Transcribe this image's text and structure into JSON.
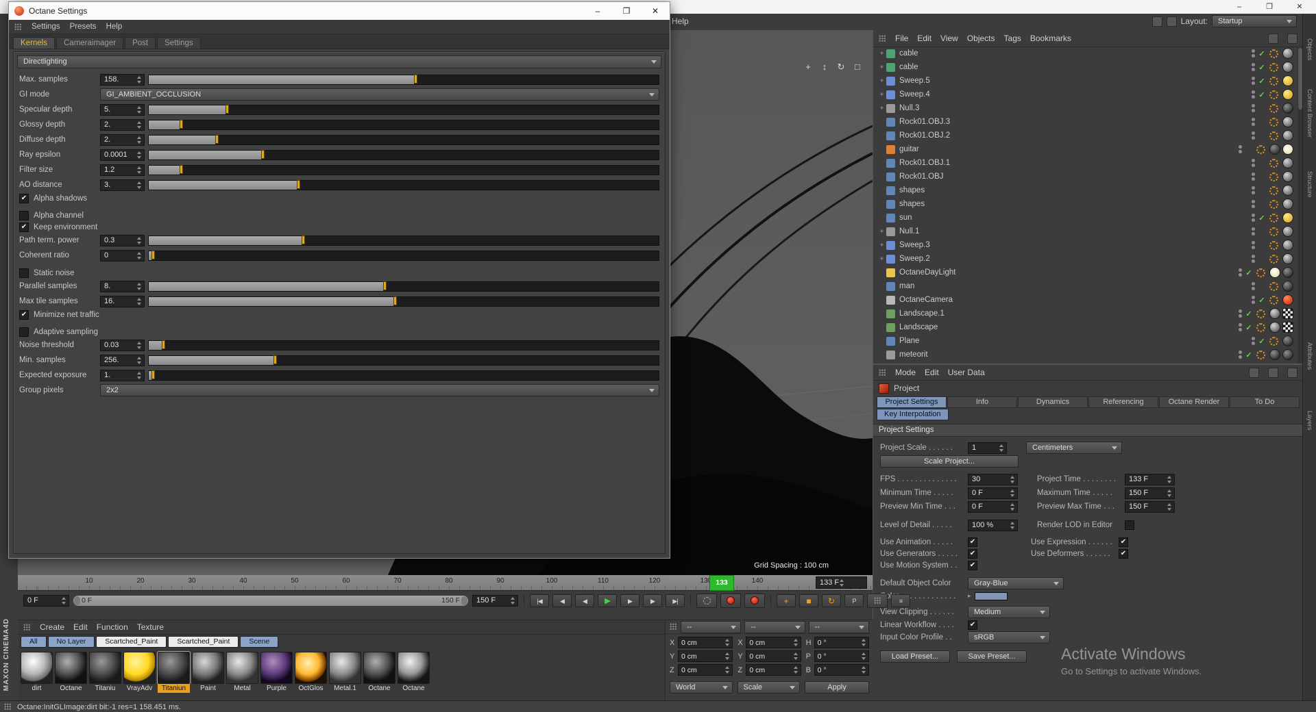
{
  "main": {
    "help": "Help",
    "layout_label": "Layout:",
    "layout_value": "Startup",
    "win_min": "–",
    "win_max": "❐",
    "win_close": "✕",
    "brand": "MAXON CINEMA4D",
    "grid_spacing": "Grid Spacing : 100 cm",
    "watermark1": "Activate Windows",
    "watermark2": "Go to Settings to activate Windows.",
    "status": "Octane:InitGLImage:dirt  bit:-1 res=1  158.451 ms.",
    "nav_icons": [
      "+",
      "↕",
      "↻",
      "□"
    ],
    "side_tabs_top": [
      "Objects",
      "Content Browser",
      "Structure"
    ],
    "side_tabs_bottom": [
      "Attributes",
      "Layers"
    ]
  },
  "dialog": {
    "title": "Octane Settings",
    "menus": [
      "Settings",
      "Presets",
      "Help"
    ],
    "tabs": [
      "Kernels",
      "Cameraimager",
      "Post",
      "Settings"
    ],
    "preset": "Directlighting",
    "rows": [
      {
        "label": "Max. samples",
        "value": "158.",
        "fill": "width:52%"
      },
      {
        "label": "GI mode",
        "value": "GI_AMBIENT_OCCLUSION"
      },
      {
        "label": "Specular depth",
        "value": "5.",
        "fill": "width:15%"
      },
      {
        "label": "Glossy depth",
        "value": "2.",
        "fill": "width:6%"
      },
      {
        "label": "Diffuse depth",
        "value": "2.",
        "fill": "width:13%"
      },
      {
        "label": "Ray epsilon",
        "value": "0.0001",
        "fill": "width:22%"
      },
      {
        "label": "Filter size",
        "value": "1.2",
        "fill": "width:6%"
      },
      {
        "label": "AO distance",
        "value": "3.",
        "fill": "width:29%"
      },
      {
        "label": "Alpha shadows",
        "check": "✔"
      },
      {
        "label": "Alpha channel",
        "check": ""
      },
      {
        "label": "Keep environment",
        "check": "✔"
      },
      {
        "label": "Path term. power",
        "value": "0.3",
        "fill": "width:30%"
      },
      {
        "label": "Coherent ratio",
        "value": "0",
        "fill": "width:0.5%"
      },
      {
        "label": "Static noise",
        "check": ""
      },
      {
        "label": "Parallel samples",
        "value": "8.",
        "fill": "width:46%"
      },
      {
        "label": "Max tile samples",
        "value": "16.",
        "fill": "width:48%"
      },
      {
        "label": "Minimize net traffic",
        "check": "✔"
      },
      {
        "label": "Adaptive sampling",
        "check": ""
      },
      {
        "label": "Noise threshold",
        "value": "0.03",
        "fill": "width:2.5%"
      },
      {
        "label": "Min. samples",
        "value": "256.",
        "fill": "width:24.5%"
      },
      {
        "label": "Expected exposure",
        "value": "1.",
        "fill": "width:0.5%"
      },
      {
        "label": "Group pixels",
        "value": "2x2"
      }
    ]
  },
  "om": {
    "menus": [
      "File",
      "Edit",
      "View",
      "Objects",
      "Tags",
      "Bookmarks"
    ],
    "items": [
      {
        "name": "cable",
        "exp": "+",
        "icon": "background:#4fa372",
        "chk": "✓",
        "t1": "display:inline-block;background:radial-gradient(circle at 35% 30%,#d6d6d6,#404040)"
      },
      {
        "name": "cable",
        "exp": "+",
        "icon": "background:#4fa372",
        "chk": "✓",
        "t1": "display:inline-block;background:radial-gradient(circle at 35% 30%,#d6d6d6,#404040)"
      },
      {
        "name": "Sweep.5",
        "exp": "+",
        "icon": "background:#6e8fd6",
        "chk": "✓",
        "t1": "display:inline-block;background:radial-gradient(circle at 35% 30%,#ffe98a,#cf9d14)"
      },
      {
        "name": "Sweep.4",
        "exp": "+",
        "icon": "background:#6e8fd6",
        "chk": "✓",
        "t1": "display:inline-block;background:radial-gradient(circle at 35% 30%,#ffe98a,#cf9d14)"
      },
      {
        "name": "Null.3",
        "exp": "+",
        "icon": "background:#9a9a9a",
        "t1": "display:inline-block;background:radial-gradient(circle at 35% 30%,#8f8f8f,#101010)"
      },
      {
        "name": "Rock01.OBJ.3",
        "icon": "background:#5f87b7",
        "t1": "display:inline-block;background:radial-gradient(circle at 35% 30%,#d6d6d6,#404040)"
      },
      {
        "name": "Rock01.OBJ.2",
        "icon": "background:#5f87b7",
        "t1": "display:inline-block;background:radial-gradient(circle at 35% 30%,#d6d6d6,#404040)"
      },
      {
        "name": "guitar",
        "icon": "background:#e08030",
        "t1": "display:inline-block;background:radial-gradient(circle at 35% 30%,#8f8f8f,#101010)",
        "t2": "display:inline-block;background:radial-gradient(circle at 45% 40%,#ffffff,#d8d890)"
      },
      {
        "name": "Rock01.OBJ.1",
        "icon": "background:#5f87b7",
        "t1": "display:inline-block;background:radial-gradient(circle at 35% 30%,#d6d6d6,#404040)"
      },
      {
        "name": "Rock01.OBJ",
        "icon": "background:#5f87b7",
        "t1": "display:inline-block;background:radial-gradient(circle at 35% 30%,#d6d6d6,#404040)"
      },
      {
        "name": "shapes",
        "icon": "background:#5f87b7",
        "t1": "display:inline-block;background:radial-gradient(circle at 35% 30%,#d6d6d6,#404040)"
      },
      {
        "name": "shapes",
        "icon": "background:#5f87b7",
        "t1": "display:inline-block;background:radial-gradient(circle at 35% 30%,#d6d6d6,#404040)"
      },
      {
        "name": "sun",
        "icon": "background:#5f87b7",
        "chk": "✓",
        "t1": "display:inline-block;background:radial-gradient(circle at 35% 30%,#ffe98a,#cf9d14)"
      },
      {
        "name": "Null.1",
        "exp": "+",
        "icon": "background:#9a9a9a",
        "t1": "display:inline-block;background:radial-gradient(circle at 35% 30%,#d6d6d6,#404040)"
      },
      {
        "name": "Sweep.3",
        "exp": "+",
        "icon": "background:#6e8fd6",
        "t1": "display:inline-block;background:radial-gradient(circle at 35% 30%,#d6d6d6,#404040)"
      },
      {
        "name": "Sweep.2",
        "exp": "+",
        "icon": "background:#6e8fd6",
        "t1": "display:inline-block;background:radial-gradient(circle at 35% 30%,#d6d6d6,#404040)"
      },
      {
        "name": "OctaneDayLight",
        "icon": "background:#e8c84a",
        "chk": "✓",
        "t1": "display:inline-block;background:radial-gradient(circle at 45% 40%,#ffffff,#d8d890)",
        "t2": "display:inline-block;background:radial-gradient(circle at 35% 30%,#8f8f8f,#101010)"
      },
      {
        "name": "man",
        "icon": "background:#5f87b7",
        "t1": "display:inline-block;background:radial-gradient(circle at 35% 30%,#8f8f8f,#101010)"
      },
      {
        "name": "OctaneCamera",
        "icon": "background:#b8b8b8",
        "chk": "✓",
        "t1": "display:inline-block;background:radial-gradient(circle at 35% 30%,#ff8a5a,#bf2000)"
      },
      {
        "name": "Landscape.1",
        "icon": "background:#6f9f5f",
        "chk": "✓",
        "t1": "display:inline-block;background:radial-gradient(circle at 35% 30%,#d6d6d6,#404040)",
        "t2": "display:inline-block;border-radius:3px;background:repeating-conic-gradient(#161616 0% 25%,#ededed 0% 50%);background-size:7px 7px"
      },
      {
        "name": "Landscape",
        "icon": "background:#6f9f5f",
        "chk": "✓",
        "t1": "display:inline-block;background:radial-gradient(circle at 35% 30%,#d6d6d6,#404040)",
        "t2": "display:inline-block;border-radius:3px;background:repeating-conic-gradient(#161616 0% 25%,#ededed 0% 50%);background-size:7px 7px"
      },
      {
        "name": "Plane",
        "icon": "background:#5f87b7",
        "chk": "✓",
        "t1": "display:inline-block;background:radial-gradient(circle at 35% 30%,#8f8f8f,#101010)"
      },
      {
        "name": "meteorit",
        "icon": "background:#9a9a9a",
        "chk": "✓",
        "t1": "display:inline-block;background:radial-gradient(circle at 35% 30%,#8f8f8f,#101010)",
        "t2": "display:inline-block;background:radial-gradient(circle at 35% 30%,#8f8f8f,#101010)"
      }
    ]
  },
  "attr": {
    "menus": [
      "Mode",
      "Edit",
      "User Data"
    ],
    "object": "Project",
    "tabs": [
      "Project Settings",
      "Info",
      "Dynamics",
      "Referencing",
      "Octane Render",
      "To Do"
    ],
    "tab_key": "Key Interpolation",
    "section": "Project Settings",
    "scale_label": "Project Scale . . . . . .",
    "scale_value": "1",
    "scale_unit": "Centimeters",
    "scale_btn": "Scale Project...",
    "fps_label": "FPS . . . . . . . . . . . . . .",
    "fps": "30",
    "ptime_label": "Project Time . . . . . . . .",
    "ptime": "133 F",
    "mint_label": "Minimum Time . . . . .",
    "mint": "0 F",
    "maxt_label": "Maximum Time . . . . .",
    "maxt": "150 F",
    "pmin_label": "Preview Min Time . . .",
    "pmin": "0 F",
    "pmax_label": "Preview Max Time . . .",
    "pmax": "150 F",
    "lod_label": "Level of Detail . . . . .",
    "lod": "100 %",
    "rlod_label": "Render LOD in Editor",
    "rlod_check": "",
    "ua_label": "Use Animation . . . . .",
    "ua": "✔",
    "ue_label": "Use Expression . . . . . .",
    "ue": "✔",
    "ug_label": "Use Generators . . . . .",
    "ug": "✔",
    "ud_label": "Use Deformers . . . . . .",
    "ud": "✔",
    "um_label": "Use Motion System . .",
    "um": "✔",
    "doc_label": "Default Object Color",
    "doc": "Gray-Blue",
    "color_label": "Color . . . . . . . . . . . . .",
    "color_swatch_style": "background:#8296b4",
    "clip_label": "View Clipping . . . . . .",
    "clip": "Medium",
    "lw_label": "Linear Workflow . . . .",
    "lw": "✔",
    "icp_label": "Input Color Profile . .",
    "icp": "sRGB",
    "load_btn": "Load Preset...",
    "save_btn": "Save Preset..."
  },
  "timeline": {
    "ticks": [
      "10",
      "20",
      "30",
      "40",
      "50",
      "60",
      "70",
      "80",
      "90",
      "100",
      "110",
      "120",
      "130",
      "140"
    ],
    "marker": "133",
    "frame_field": "133 F",
    "start": "0 F",
    "range_left": "0 F",
    "range_right": "150 F",
    "end": "150 F",
    "transport": [
      "|◀",
      "◀",
      "◀",
      "▶",
      "▶",
      "▶",
      "▶|"
    ],
    "tools": [
      "+",
      "■",
      "↻",
      "P",
      "≡"
    ]
  },
  "materials": {
    "menus": [
      "Create",
      "Edit",
      "Function",
      "Texture"
    ],
    "tabs": [
      "All",
      "No Layer",
      "Scartched_Paint",
      "Scartched_Paint",
      "Scene"
    ],
    "items": [
      {
        "name": "dirt",
        "style": "background:radial-gradient(circle at 38% 30%,#ffffff,#b8b8b8 42%,#6a6a6a 66%,#222222 70%)"
      },
      {
        "name": "Octane",
        "style": "background:radial-gradient(circle at 38% 30%,#b0b0b0,#555555 42%,#161616 66%,#111111 70%)"
      },
      {
        "name": "Titaniu",
        "style": "background:radial-gradient(circle at 38% 30%,#9a9a9a,#4a4a4a 45%,#1a1a1a 70%)"
      },
      {
        "name": "VrayAdv",
        "style": "background:radial-gradient(circle at 38% 30%,#fff3a0,#ffd820 45%,#b88a00 66%,#222222 70%)"
      },
      {
        "name": "Titaniun",
        "style": "background:radial-gradient(circle at 38% 30%,#9a9a9a,#4a4a4a 45%,#1a1a1a 70%)"
      },
      {
        "name": "Paint",
        "style": "background:radial-gradient(circle at 38% 30%,#d8d8d8,#777777 45%,#222222 70%)"
      },
      {
        "name": "Metal",
        "style": "background:radial-gradient(circle at 38% 30%,#e8e8e8,#8a8a8a 45%,#333333 70%)"
      },
      {
        "name": "Purple",
        "style": "background:radial-gradient(circle at 38% 30%,#b090c0,#5a3a7a 45%,#140a20 70%)"
      },
      {
        "name": "OctGlos",
        "style": "background:radial-gradient(circle at 40% 35%,#fff0b0,#ffb830 42%,#7a3a00 66%,#1a1208 70%)"
      },
      {
        "name": "Metal.1",
        "style": "background:radial-gradient(circle at 38% 30%,#e8e8e8,#8a8a8a 45%,#333333 70%)"
      },
      {
        "name": "Octane",
        "style": "background:radial-gradient(circle at 38% 30%,#b0b0b0,#555555 42%,#161616 66%,#111111 70%)"
      },
      {
        "name": "Octane",
        "style": "background:radial-gradient(circle at 38% 30%,#f0f0f0,#999999 42%,#2a2a2a 66%,#151515 70%)"
      }
    ]
  },
  "coords": {
    "headers": [
      "--",
      "--",
      "--"
    ],
    "r1": {
      "a": "X",
      "av": "0 cm",
      "b": "X",
      "bv": "0 cm",
      "c": "H",
      "cv": "0 °"
    },
    "r2": {
      "a": "Y",
      "av": "0 cm",
      "b": "Y",
      "bv": "0 cm",
      "c": "P",
      "cv": "0 °"
    },
    "r3": {
      "a": "Z",
      "av": "0 cm",
      "b": "Z",
      "bv": "0 cm",
      "c": "B",
      "cv": "0 °"
    },
    "world": "World",
    "scale": "Scale",
    "apply": "Apply"
  }
}
